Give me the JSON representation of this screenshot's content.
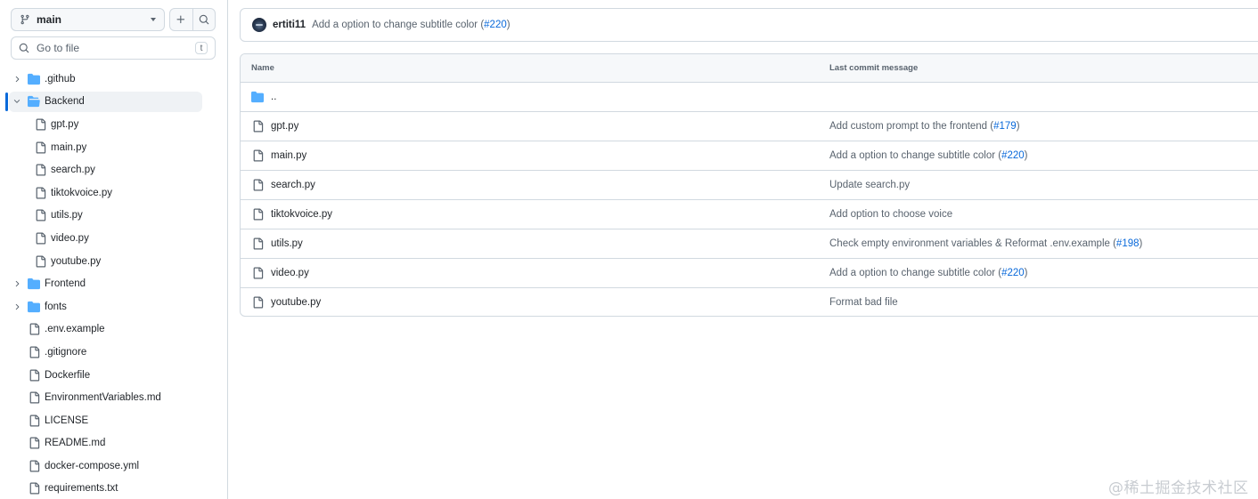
{
  "sidebar": {
    "branch": "main",
    "goto_placeholder": "Go to file",
    "goto_shortcut": "t",
    "tree": [
      {
        "label": ".github",
        "type": "folder",
        "expandable": true,
        "expanded": false,
        "depth": 0
      },
      {
        "label": "Backend",
        "type": "folder",
        "expandable": true,
        "expanded": true,
        "depth": 0,
        "selected": true
      },
      {
        "label": "gpt.py",
        "type": "file",
        "depth": 1
      },
      {
        "label": "main.py",
        "type": "file",
        "depth": 1
      },
      {
        "label": "search.py",
        "type": "file",
        "depth": 1
      },
      {
        "label": "tiktokvoice.py",
        "type": "file",
        "depth": 1
      },
      {
        "label": "utils.py",
        "type": "file",
        "depth": 1
      },
      {
        "label": "video.py",
        "type": "file",
        "depth": 1
      },
      {
        "label": "youtube.py",
        "type": "file",
        "depth": 1
      },
      {
        "label": "Frontend",
        "type": "folder",
        "expandable": true,
        "expanded": false,
        "depth": 0
      },
      {
        "label": "fonts",
        "type": "folder",
        "expandable": true,
        "expanded": false,
        "depth": 0
      },
      {
        "label": ".env.example",
        "type": "file",
        "depth": 0
      },
      {
        "label": ".gitignore",
        "type": "file",
        "depth": 0
      },
      {
        "label": "Dockerfile",
        "type": "file",
        "depth": 0
      },
      {
        "label": "EnvironmentVariables.md",
        "type": "file",
        "depth": 0
      },
      {
        "label": "LICENSE",
        "type": "file",
        "depth": 0
      },
      {
        "label": "README.md",
        "type": "file",
        "depth": 0
      },
      {
        "label": "docker-compose.yml",
        "type": "file",
        "depth": 0
      },
      {
        "label": "requirements.txt",
        "type": "file",
        "depth": 0
      }
    ]
  },
  "commit": {
    "author": "ertiti11",
    "message": "Add a option to change subtitle color (",
    "ref": "#220",
    "close": ")"
  },
  "table": {
    "headers": {
      "name": "Name",
      "message": "Last commit message"
    },
    "rows": [
      {
        "name": "..",
        "type": "folder",
        "message": "",
        "ref": "",
        "close": ""
      },
      {
        "name": "gpt.py",
        "type": "file",
        "message": "Add custom prompt to the frontend (",
        "ref": "#179",
        "close": ")"
      },
      {
        "name": "main.py",
        "type": "file",
        "message": "Add a option to change subtitle color (",
        "ref": "#220",
        "close": ")"
      },
      {
        "name": "search.py",
        "type": "file",
        "message": "Update search.py",
        "ref": "",
        "close": ""
      },
      {
        "name": "tiktokvoice.py",
        "type": "file",
        "message": "Add option to choose voice",
        "ref": "",
        "close": ""
      },
      {
        "name": "utils.py",
        "type": "file",
        "message": "Check empty environment variables & Reformat .env.example (",
        "ref": "#198",
        "close": ")"
      },
      {
        "name": "video.py",
        "type": "file",
        "message": "Add a option to change subtitle color (",
        "ref": "#220",
        "close": ")"
      },
      {
        "name": "youtube.py",
        "type": "file",
        "message": "Format bad file",
        "ref": "",
        "close": ""
      }
    ]
  },
  "watermark": "@稀土掘金技术社区",
  "colors": {
    "accent": "#0969da",
    "folder": "#54aeff",
    "border": "#d1d9e0",
    "muted": "#59636e"
  },
  "icons": {
    "branch": "git-branch-icon",
    "add": "plus-icon",
    "search": "search-icon",
    "folder": "folder-icon",
    "file": "file-icon",
    "chevron": "chevron-icon"
  }
}
